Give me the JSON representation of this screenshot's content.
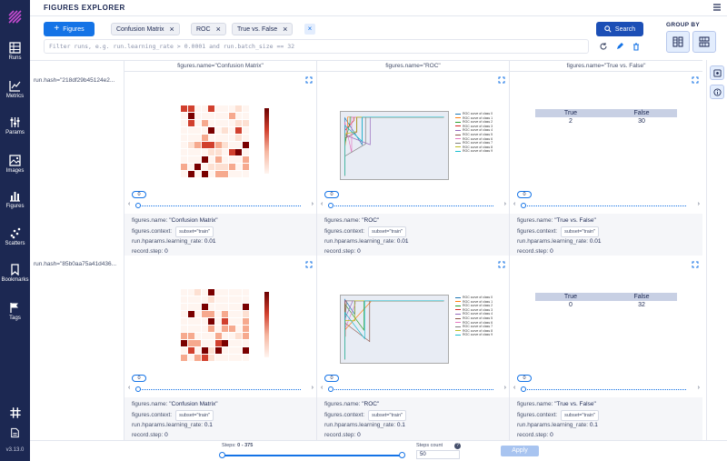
{
  "app": {
    "page_title": "FIGURES EXPLORER",
    "version": "v3.13.0"
  },
  "sidebar": {
    "items": [
      {
        "label": "Runs",
        "icon": "table-icon"
      },
      {
        "label": "Metrics",
        "icon": "line-chart-icon"
      },
      {
        "label": "Params",
        "icon": "sliders-icon"
      },
      {
        "label": "Images",
        "icon": "image-icon"
      },
      {
        "label": "Figures",
        "icon": "bar-chart-icon"
      },
      {
        "label": "Scatters",
        "icon": "scatter-icon"
      },
      {
        "label": "Bookmarks",
        "icon": "bookmark-icon"
      },
      {
        "label": "Tags",
        "icon": "flag-icon"
      }
    ]
  },
  "toolbar": {
    "add_button_label": "Figures",
    "chips": [
      "Confusion Matrix",
      "ROC",
      "True vs. False"
    ],
    "search_label": "Search",
    "filter_placeholder": "Filter runs, e.g. run.learning_rate > 0.0001 and run.batch_size == 32",
    "group_by_label": "GROUP BY"
  },
  "grid": {
    "columns": [
      "figures.name=\"Confusion Matrix\"",
      "figures.name=\"ROC\"",
      "figures.name=\"True vs. False\""
    ],
    "rows": [
      {
        "header": "run.hash=\"218df29b45124e2...",
        "step_value": "0",
        "cells": [
          {
            "name": "\"Confusion Matrix\"",
            "context": "subset=\"train\"",
            "lr": "0.01",
            "step": "0"
          },
          {
            "name": "\"ROC\"",
            "context": "subset=\"train\"",
            "lr": "0.01",
            "step": "0"
          },
          {
            "name": "\"True vs. False\"",
            "context": "subset=\"train\"",
            "lr": "0.01",
            "step": "0"
          }
        ],
        "table": {
          "headers": [
            "True",
            "False"
          ],
          "values": [
            "2",
            "30"
          ]
        }
      },
      {
        "header": "run.hash=\"85b0aa75a41d436...",
        "step_value": "0",
        "cells": [
          {
            "name": "\"Confusion Matrix\"",
            "context": "subset=\"train\"",
            "lr": "0.1",
            "step": "0"
          },
          {
            "name": "\"ROC\"",
            "context": "subset=\"train\"",
            "lr": "0.1",
            "step": "0"
          },
          {
            "name": "\"True vs. False\"",
            "context": "subset=\"train\"",
            "lr": "0.1",
            "step": "0"
          }
        ],
        "table": {
          "headers": [
            "True",
            "False"
          ],
          "values": [
            "0",
            "32"
          ]
        }
      }
    ],
    "info_labels": {
      "name": "figures.name:",
      "context": "figures.context:",
      "lr": "run.hparams.learning_rate:",
      "step": "record.step:"
    }
  },
  "roc_legend": [
    "ROC curve of class 0",
    "ROC curve of class 1",
    "ROC curve of class 2",
    "ROC curve of class 3",
    "ROC curve of class 4",
    "ROC curve of class 5",
    "ROC curve of class 6",
    "ROC curve of class 7",
    "ROC curve of class 8",
    "ROC curve of class 9"
  ],
  "bottom": {
    "steps_label": "Steps:",
    "steps_range": "0 - 375",
    "count_label": "Steps count",
    "count_value": "50",
    "apply_label": "Apply"
  },
  "colors": {
    "sidebar_bg": "#1c2852",
    "accent": "#1473e6",
    "search_bg": "#1c4fb6"
  }
}
